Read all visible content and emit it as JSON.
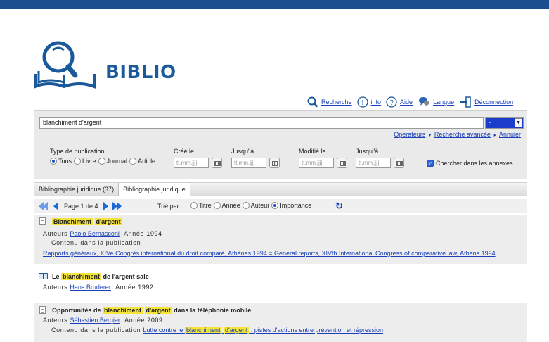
{
  "brand": {
    "name": "BIBLIO"
  },
  "topnav": [
    {
      "label": "Recherche",
      "icon": "search-icon"
    },
    {
      "label": "info",
      "icon": "info-icon"
    },
    {
      "label": "Aide",
      "icon": "help-icon"
    },
    {
      "label": "Langue",
      "icon": "language-icon"
    },
    {
      "label": "Déconnection",
      "icon": "logout-icon"
    }
  ],
  "search": {
    "query": "blanchiment d'argent",
    "select_value": "-",
    "operators": "Operateurs",
    "advanced": "Recherche avancée",
    "cancel": "Annuler"
  },
  "filters": {
    "type_label": "Type de publication",
    "types": [
      "Tous",
      "Livre",
      "Journal",
      "Article"
    ],
    "types_selected": "Tous",
    "created_label": "Créé le",
    "until_label": "Jusqu\"à",
    "modified_label": "Modifié le",
    "until2_label": "Jusqu\"à",
    "date_placeholder": "tt.mm.jjjj",
    "annexes_label": "Chercher dans les annexes",
    "annexes_checked": true
  },
  "tabs": [
    "Bibliographie juridique (37)",
    "Bibliographie juridique"
  ],
  "pager": {
    "page_text": "Page 1 de 4",
    "sort_label": "Trié par",
    "sort_options": [
      "Titre",
      "Année",
      "Auteur",
      "Importance"
    ],
    "sort_selected": "Importance"
  },
  "results": [
    {
      "title_parts": [
        "Blanchiment",
        " ",
        "d'argent"
      ],
      "authors_label": "Auteurs",
      "author": "Paolo Bernasconi",
      "year_label": "Année",
      "year": "1994",
      "contained_label": "Contenu dans la publication",
      "publication": "Rapports généraux, XIVe Congrès international du droit comparé, Athènes 1994 = General reports, XIVth International Congress of comparative law, Athens 1994"
    },
    {
      "title_pre": "Le ",
      "title_hl": "blanchiment",
      "title_post": " de l'argent sale",
      "authors_label": "Auteurs",
      "author": "Hans Bruderer",
      "year_label": "Année",
      "year": "1992"
    },
    {
      "title_pre": "Opportunités de ",
      "title_hl1": "blanchiment",
      "title_hl2": "d'argent",
      "title_post": " dans la téléphonie mobile",
      "authors_label": "Auteurs",
      "author": "Sébastien Bergier",
      "year_label": "Année",
      "year": "2009",
      "contained_label": "Contenu dans la publication",
      "pub_pre": "Lutte contre le ",
      "pub_hl1": "blanchiment",
      "pub_mid": " ",
      "pub_hl2": "d'argent",
      "pub_post": " : pistes d'actions entre prévention et répression"
    }
  ]
}
